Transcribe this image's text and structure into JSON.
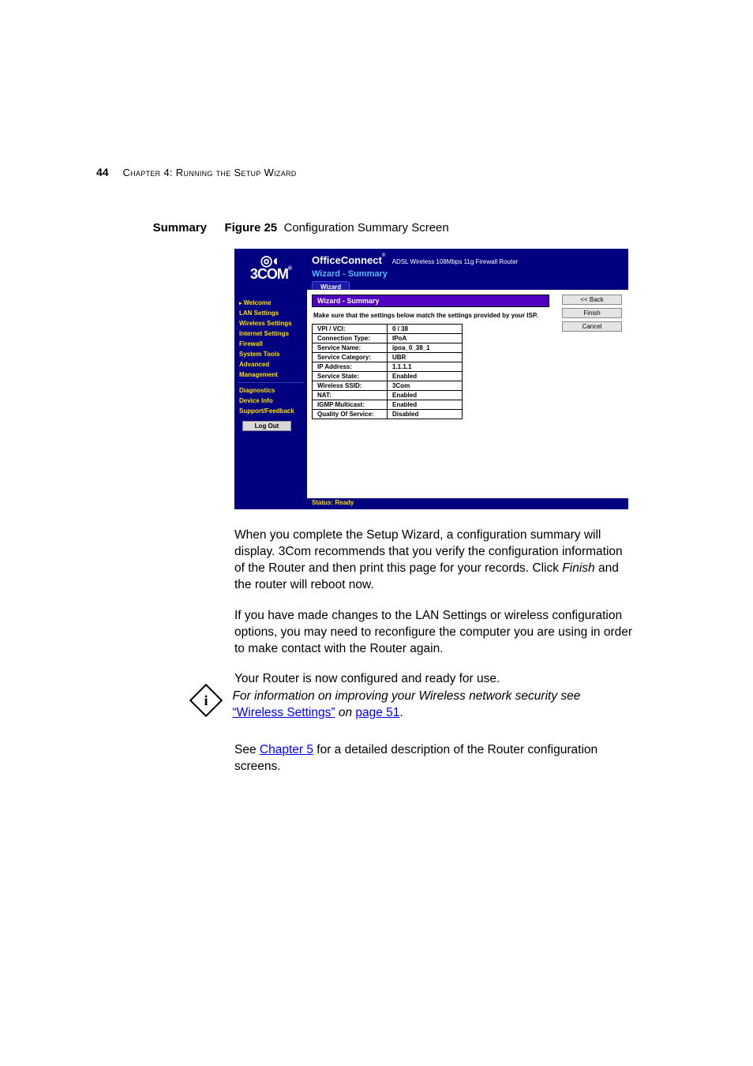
{
  "page_number": "44",
  "chapter_line": "Chapter 4: Running the Setup Wizard",
  "section_label": "Summary",
  "figure_label": "Figure 25",
  "figure_caption": "Configuration Summary Screen",
  "screenshot": {
    "logo_brand": "3COM",
    "header_product": "OfficeConnect",
    "header_product_sub": "ADSL Wireless 108Mbps 11g Firewall Router",
    "header_wizard": "Wizard - Summary",
    "tab_label": "Wizard",
    "panel_title": "Wizard - Summary",
    "instruction": "Make sure that the settings below match the settings provided by your ISP.",
    "sidebar": [
      "Welcome",
      "LAN Settings",
      "Wireless Settings",
      "Internet Settings",
      "Firewall",
      "System Tools",
      "Advanced",
      "Management"
    ],
    "sidebar2": [
      "Diagnostics",
      "Device Info",
      "Support/Feedback"
    ],
    "logout_label": "Log Out",
    "rows": [
      {
        "k": "VPI / VCI:",
        "v": "0 / 38"
      },
      {
        "k": "Connection Type:",
        "v": "IPoA"
      },
      {
        "k": "Service Name:",
        "v": "ipoa_0_38_1"
      },
      {
        "k": "Service Category:",
        "v": "UBR"
      },
      {
        "k": "IP Address:",
        "v": "1.1.1.1"
      },
      {
        "k": "Service State:",
        "v": "Enabled"
      },
      {
        "k": "Wireless SSID:",
        "v": "3Com"
      },
      {
        "k": "NAT:",
        "v": "Enabled"
      },
      {
        "k": "IGMP Multicast:",
        "v": "Enabled"
      },
      {
        "k": "Quality Of Service:",
        "v": "Disabled"
      }
    ],
    "buttons": {
      "back": "<< Back",
      "finish": "Finish",
      "cancel": "Cancel"
    },
    "status": "Status: Ready"
  },
  "para1a": "When you complete the Setup Wizard, a configuration summary will display. 3Com recommends that you verify the configuration information of the Router and then print this page for your records. Click ",
  "para1_finish": "Finish",
  "para1b": " and the router will reboot now.",
  "para2": "If you have made changes to the LAN Settings or wireless configuration options, you may need to reconfigure the computer you are using in order to make contact with the Router again.",
  "para3": "Your Router is now configured and ready for use.",
  "note_a": "For information on improving your Wireless network security see ",
  "note_link1": "“Wireless Settings”",
  "note_b": " on ",
  "note_link2": "page 51",
  "note_c": ".",
  "after_a": "See ",
  "after_link": "Chapter 5",
  "after_b": " for a detailed description of the Router configuration screens."
}
